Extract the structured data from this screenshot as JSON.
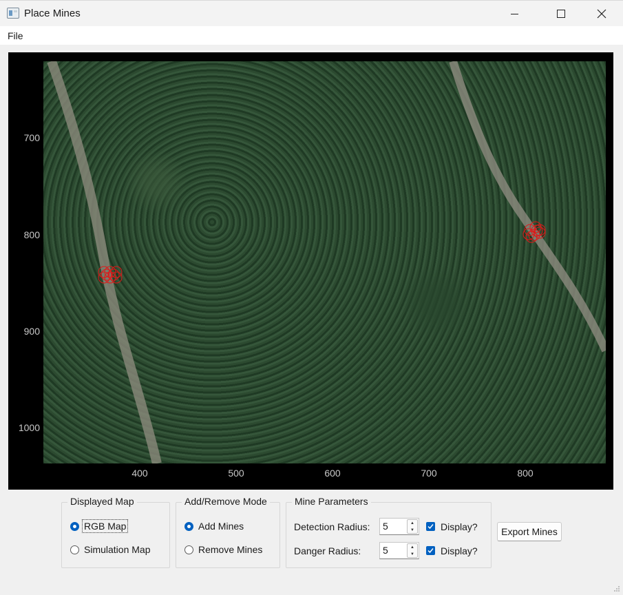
{
  "window": {
    "title": "Place Mines",
    "icons": {
      "app": "app-window-icon",
      "minimize": "minimize-icon",
      "maximize": "maximize-icon",
      "close": "close-icon"
    }
  },
  "menu": {
    "file": "File"
  },
  "plot": {
    "y_ticks": [
      "700",
      "800",
      "900",
      "1000"
    ],
    "x_ticks": [
      "400",
      "500",
      "600",
      "700",
      "800"
    ],
    "marker_color": "#e01818",
    "background_color": "#000000",
    "tick_color": "#c8c8c8"
  },
  "displayed_map": {
    "title": "Displayed Map",
    "options": [
      {
        "label": "RGB Map",
        "selected": true
      },
      {
        "label": "Simulation Map",
        "selected": false
      }
    ]
  },
  "mode": {
    "title": "Add/Remove Mode",
    "options": [
      {
        "label": "Add Mines",
        "selected": true
      },
      {
        "label": "Remove Mines",
        "selected": false
      }
    ]
  },
  "mine_params": {
    "title": "Mine Parameters",
    "detection": {
      "label": "Detection Radius:",
      "value": "5",
      "display_label": "Display?",
      "display_checked": true
    },
    "danger": {
      "label": "Danger Radius:",
      "value": "5",
      "display_label": "Display?",
      "display_checked": true
    }
  },
  "export": {
    "label": "Export Mines"
  },
  "accent_color": "#0060c0"
}
